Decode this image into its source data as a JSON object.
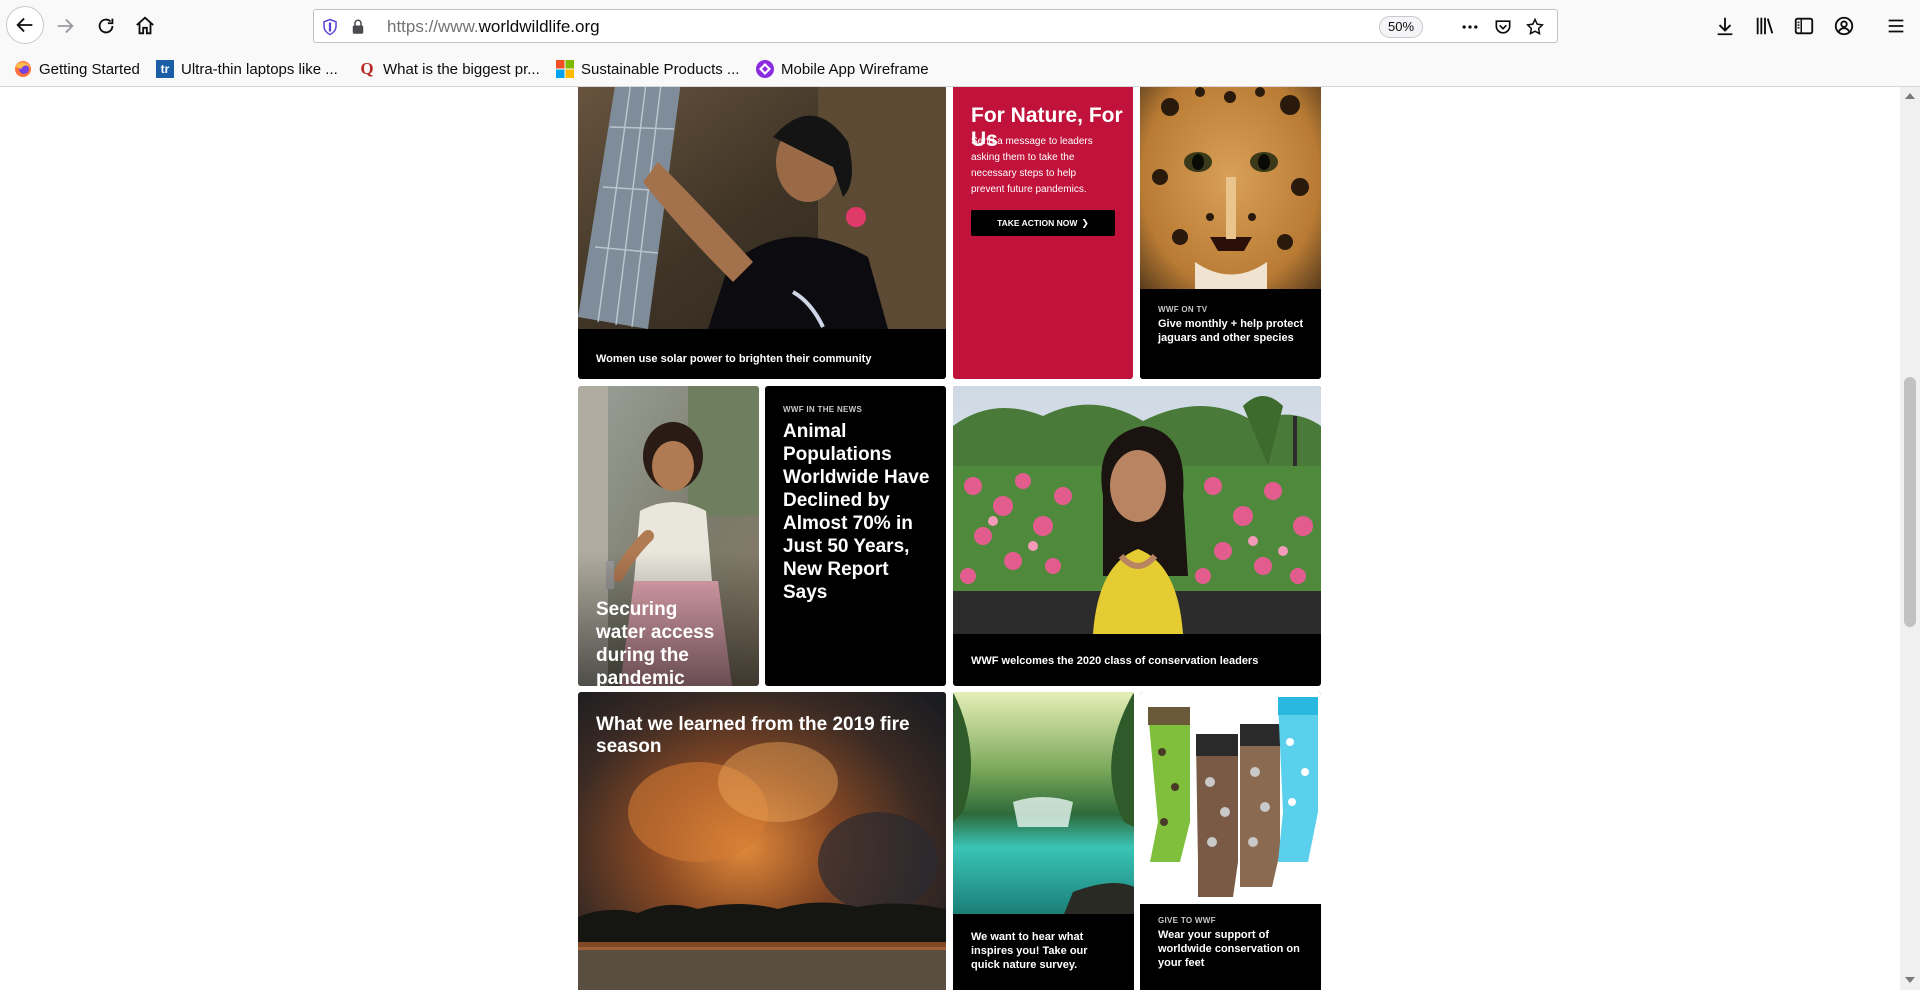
{
  "browser": {
    "url_proto": "https://www.",
    "url_domain": "worldwildlife.org",
    "zoom": "50%",
    "bookmarks": [
      {
        "label": "Getting Started",
        "icon": "firefox-icon"
      },
      {
        "label": "Ultra-thin laptops like ...",
        "icon": "tr-favicon"
      },
      {
        "label": "What is the biggest pr...",
        "icon": "quora-icon"
      },
      {
        "label": "Sustainable Products ...",
        "icon": "microsoft-icon"
      },
      {
        "label": "Mobile App Wireframe",
        "icon": "wireframe-icon"
      }
    ]
  },
  "tiles": {
    "solar": {
      "caption": "Women use solar power to brighten their community"
    },
    "nature": {
      "title": "For Nature, For Us",
      "body": "Send a message to leaders asking them to take the necessary steps to help prevent future pandemics.",
      "button": "TAKE ACTION NOW",
      "color": "#c0123a"
    },
    "jaguar": {
      "kicker": "WWF ON TV",
      "caption": "Give monthly + help protect jaguars and other species"
    },
    "water": {
      "caption": "Securing water access during the pandemic"
    },
    "news": {
      "kicker": "WWF IN THE NEWS",
      "headline": "Animal Populations Worldwide Have Declined by Almost 70% in Just 50 Years, New Report Says"
    },
    "leaders": {
      "caption": "WWF welcomes the 2020 class of conservation leaders"
    },
    "fire": {
      "headline": "What we learned from the 2019 fire season"
    },
    "survey": {
      "caption": "We want to hear what inspires you! Take our quick nature survey."
    },
    "socks": {
      "kicker": "GIVE TO WWF",
      "caption": "Wear your support of worldwide conservation on your feet"
    }
  }
}
